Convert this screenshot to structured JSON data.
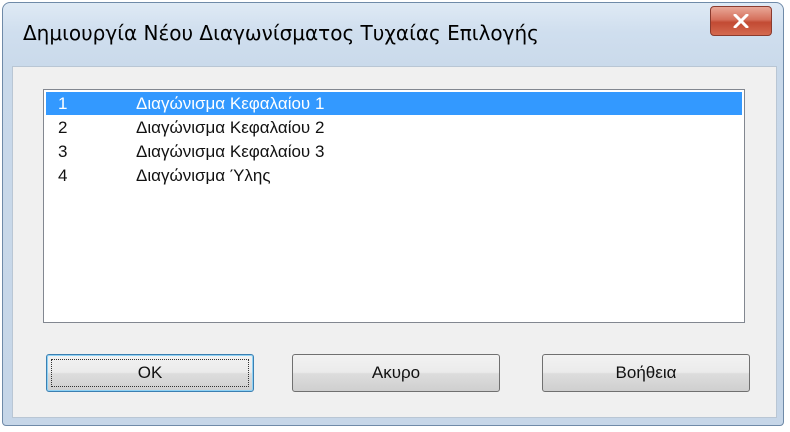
{
  "window": {
    "title": "Δημιουργία Νέου Διαγωνίσματος Τυχαίας Επιλογής",
    "close_icon": "close-icon"
  },
  "list": {
    "selected_index": 0,
    "items": [
      {
        "number": "1",
        "name": "Διαγώνισμα Κεφαλαίου 1"
      },
      {
        "number": "2",
        "name": "Διαγώνισμα Κεφαλαίου 2"
      },
      {
        "number": "3",
        "name": "Διαγώνισμα Κεφαλαίου 3"
      },
      {
        "number": "4",
        "name": "Διαγώνισμα Ύλης"
      }
    ]
  },
  "buttons": {
    "ok_label": "OK",
    "cancel_label": "Ακυρο",
    "help_label": "Βοήθεια"
  },
  "colors": {
    "selection": "#3399ff",
    "close_button": "#c24a33"
  }
}
